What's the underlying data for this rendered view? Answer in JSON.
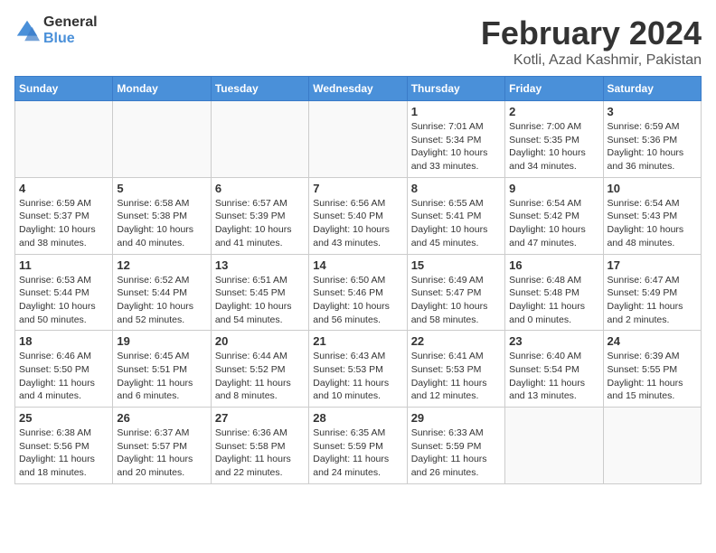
{
  "logo": {
    "general": "General",
    "blue": "Blue"
  },
  "header": {
    "month": "February 2024",
    "location": "Kotli, Azad Kashmir, Pakistan"
  },
  "weekdays": [
    "Sunday",
    "Monday",
    "Tuesday",
    "Wednesday",
    "Thursday",
    "Friday",
    "Saturday"
  ],
  "weeks": [
    [
      {
        "day": "",
        "info": ""
      },
      {
        "day": "",
        "info": ""
      },
      {
        "day": "",
        "info": ""
      },
      {
        "day": "",
        "info": ""
      },
      {
        "day": "1",
        "sunrise": "7:01 AM",
        "sunset": "5:34 PM",
        "daylight": "10 hours and 33 minutes."
      },
      {
        "day": "2",
        "sunrise": "7:00 AM",
        "sunset": "5:35 PM",
        "daylight": "10 hours and 34 minutes."
      },
      {
        "day": "3",
        "sunrise": "6:59 AM",
        "sunset": "5:36 PM",
        "daylight": "10 hours and 36 minutes."
      }
    ],
    [
      {
        "day": "4",
        "sunrise": "6:59 AM",
        "sunset": "5:37 PM",
        "daylight": "10 hours and 38 minutes."
      },
      {
        "day": "5",
        "sunrise": "6:58 AM",
        "sunset": "5:38 PM",
        "daylight": "10 hours and 40 minutes."
      },
      {
        "day": "6",
        "sunrise": "6:57 AM",
        "sunset": "5:39 PM",
        "daylight": "10 hours and 41 minutes."
      },
      {
        "day": "7",
        "sunrise": "6:56 AM",
        "sunset": "5:40 PM",
        "daylight": "10 hours and 43 minutes."
      },
      {
        "day": "8",
        "sunrise": "6:55 AM",
        "sunset": "5:41 PM",
        "daylight": "10 hours and 45 minutes."
      },
      {
        "day": "9",
        "sunrise": "6:54 AM",
        "sunset": "5:42 PM",
        "daylight": "10 hours and 47 minutes."
      },
      {
        "day": "10",
        "sunrise": "6:54 AM",
        "sunset": "5:43 PM",
        "daylight": "10 hours and 48 minutes."
      }
    ],
    [
      {
        "day": "11",
        "sunrise": "6:53 AM",
        "sunset": "5:44 PM",
        "daylight": "10 hours and 50 minutes."
      },
      {
        "day": "12",
        "sunrise": "6:52 AM",
        "sunset": "5:44 PM",
        "daylight": "10 hours and 52 minutes."
      },
      {
        "day": "13",
        "sunrise": "6:51 AM",
        "sunset": "5:45 PM",
        "daylight": "10 hours and 54 minutes."
      },
      {
        "day": "14",
        "sunrise": "6:50 AM",
        "sunset": "5:46 PM",
        "daylight": "10 hours and 56 minutes."
      },
      {
        "day": "15",
        "sunrise": "6:49 AM",
        "sunset": "5:47 PM",
        "daylight": "10 hours and 58 minutes."
      },
      {
        "day": "16",
        "sunrise": "6:48 AM",
        "sunset": "5:48 PM",
        "daylight": "11 hours and 0 minutes."
      },
      {
        "day": "17",
        "sunrise": "6:47 AM",
        "sunset": "5:49 PM",
        "daylight": "11 hours and 2 minutes."
      }
    ],
    [
      {
        "day": "18",
        "sunrise": "6:46 AM",
        "sunset": "5:50 PM",
        "daylight": "11 hours and 4 minutes."
      },
      {
        "day": "19",
        "sunrise": "6:45 AM",
        "sunset": "5:51 PM",
        "daylight": "11 hours and 6 minutes."
      },
      {
        "day": "20",
        "sunrise": "6:44 AM",
        "sunset": "5:52 PM",
        "daylight": "11 hours and 8 minutes."
      },
      {
        "day": "21",
        "sunrise": "6:43 AM",
        "sunset": "5:53 PM",
        "daylight": "11 hours and 10 minutes."
      },
      {
        "day": "22",
        "sunrise": "6:41 AM",
        "sunset": "5:53 PM",
        "daylight": "11 hours and 12 minutes."
      },
      {
        "day": "23",
        "sunrise": "6:40 AM",
        "sunset": "5:54 PM",
        "daylight": "11 hours and 13 minutes."
      },
      {
        "day": "24",
        "sunrise": "6:39 AM",
        "sunset": "5:55 PM",
        "daylight": "11 hours and 15 minutes."
      }
    ],
    [
      {
        "day": "25",
        "sunrise": "6:38 AM",
        "sunset": "5:56 PM",
        "daylight": "11 hours and 18 minutes."
      },
      {
        "day": "26",
        "sunrise": "6:37 AM",
        "sunset": "5:57 PM",
        "daylight": "11 hours and 20 minutes."
      },
      {
        "day": "27",
        "sunrise": "6:36 AM",
        "sunset": "5:58 PM",
        "daylight": "11 hours and 22 minutes."
      },
      {
        "day": "28",
        "sunrise": "6:35 AM",
        "sunset": "5:59 PM",
        "daylight": "11 hours and 24 minutes."
      },
      {
        "day": "29",
        "sunrise": "6:33 AM",
        "sunset": "5:59 PM",
        "daylight": "11 hours and 26 minutes."
      },
      {
        "day": "",
        "info": ""
      },
      {
        "day": "",
        "info": ""
      }
    ]
  ]
}
